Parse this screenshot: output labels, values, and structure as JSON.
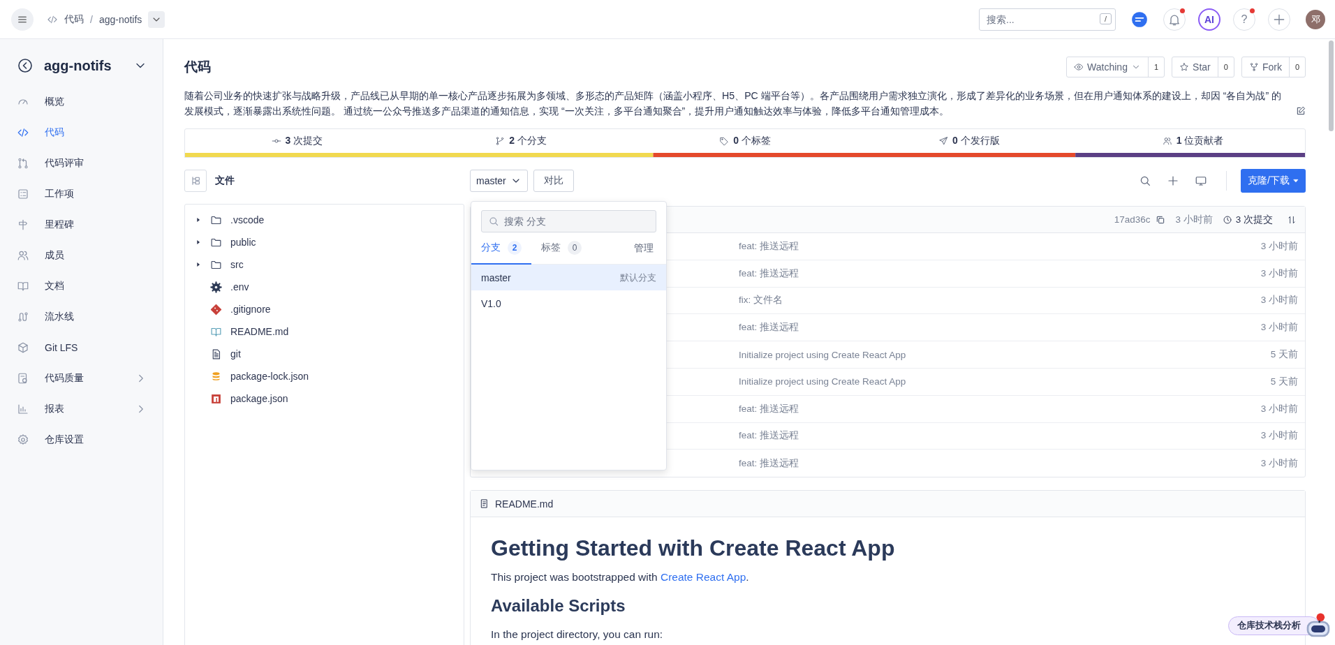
{
  "topbar": {
    "breadcrumb": [
      "代码",
      "agg-notifs"
    ],
    "separator": "/",
    "search": {
      "placeholder": "搜索...",
      "shortcut": "/"
    },
    "actions": [
      {
        "kind": "chat",
        "dot": false
      },
      {
        "kind": "bell",
        "dot": true
      },
      {
        "kind": "ai",
        "label": "AI",
        "dot": false
      },
      {
        "kind": "help",
        "label": "?",
        "dot": true
      },
      {
        "kind": "plus",
        "dot": false
      }
    ],
    "avatar": "邓"
  },
  "sidebar": {
    "repo": "agg-notifs",
    "items": [
      {
        "label": "概览",
        "selected": false,
        "expandable": false
      },
      {
        "label": "代码",
        "selected": true,
        "expandable": false
      },
      {
        "label": "代码评审",
        "selected": false,
        "expandable": false
      },
      {
        "label": "工作项",
        "selected": false,
        "expandable": false
      },
      {
        "label": "里程碑",
        "selected": false,
        "expandable": false
      },
      {
        "label": "成员",
        "selected": false,
        "expandable": false
      },
      {
        "label": "文档",
        "selected": false,
        "expandable": false
      },
      {
        "label": "流水线",
        "selected": false,
        "expandable": false
      },
      {
        "label": "Git LFS",
        "selected": false,
        "expandable": false
      },
      {
        "label": "代码质量",
        "selected": false,
        "expandable": true
      },
      {
        "label": "报表",
        "selected": false,
        "expandable": true
      },
      {
        "label": "仓库设置",
        "selected": false,
        "expandable": false
      }
    ]
  },
  "header": {
    "title": "代码",
    "buttons": [
      {
        "label": "Watching",
        "count": "1",
        "dropdown": true
      },
      {
        "label": "Star",
        "count": "0",
        "dropdown": false
      },
      {
        "label": "Fork",
        "count": "0",
        "dropdown": false
      }
    ],
    "description": "随着公司业务的快速扩张与战略升级，产品线已从早期的单一核心产品逐步拓展为多领域、多形态的产品矩阵（涵盖小程序、H5、PC 端平台等）。各产品围绕用户需求独立演化，形成了差异化的业务场景，但在用户通知体系的建设上，却因 “各自为战” 的发展模式，逐渐暴露出系统性问题。 通过统一公众号推送多产品渠道的通知信息，实现 “一次关注，多平台通知聚合”，提升用户通知触达效率与体验，降低多平台通知管理成本。"
  },
  "stats": [
    {
      "text": "**3** 次提交"
    },
    {
      "text": "**2** 个分支"
    },
    {
      "text": "**0** 个标签"
    },
    {
      "text": "**0** 个发行版"
    },
    {
      "text": "**1** 位贡献者"
    }
  ],
  "toolbar": {
    "files_label": "文件",
    "branch": "master",
    "compare": "对比",
    "clone": "克隆/下载"
  },
  "file_tree": [
    {
      "name": ".vscode",
      "kind": "folder"
    },
    {
      "name": "public",
      "kind": "folder"
    },
    {
      "name": "src",
      "kind": "folder"
    },
    {
      "name": ".env",
      "kind": "config"
    },
    {
      "name": ".gitignore",
      "kind": "git"
    },
    {
      "name": "README.md",
      "kind": "markdown"
    },
    {
      "name": "git",
      "kind": "text"
    },
    {
      "name": "package-lock.json",
      "kind": "lockfile"
    },
    {
      "name": "package.json",
      "kind": "package"
    }
  ],
  "branch_menu": {
    "placeholder": "搜索 分支",
    "tabs": [
      {
        "label": "分支",
        "count": "2",
        "selected": true
      },
      {
        "label": "标签",
        "count": "0",
        "selected": false
      }
    ],
    "manage": "管理",
    "branches": [
      {
        "name": "master",
        "badge": "默认分支",
        "selected": true
      },
      {
        "name": "V1.0",
        "selected": false
      }
    ]
  },
  "commits": {
    "hash": "17ad36c",
    "time": "3 小时前",
    "count": "3 次提交",
    "rows": [
      {
        "message": "feat: 推送远程",
        "time": "3 小时前"
      },
      {
        "message": "feat: 推送远程",
        "time": "3 小时前"
      },
      {
        "message": "fix: 文件名",
        "time": "3 小时前"
      },
      {
        "message": "feat: 推送远程",
        "time": "3 小时前"
      },
      {
        "message": "Initialize project using Create React App",
        "time": "5 天前"
      },
      {
        "message": "Initialize project using Create React App",
        "time": "5 天前"
      },
      {
        "message": "feat: 推送远程",
        "time": "3 小时前"
      },
      {
        "message": "feat: 推送远程",
        "time": "3 小时前"
      },
      {
        "message": "feat: 推送远程",
        "time": "3 小时前"
      }
    ]
  },
  "readme": {
    "filename": "README.md",
    "heading": "Getting Started with Create React App",
    "intro": {
      "before": "This project was bootstrapped with ",
      "link": "Create React App",
      "after": "."
    },
    "subheading": "Available Scripts",
    "text": "In the project directory, you can run:"
  },
  "assistant": {
    "label": "仓库技术栈分析"
  }
}
